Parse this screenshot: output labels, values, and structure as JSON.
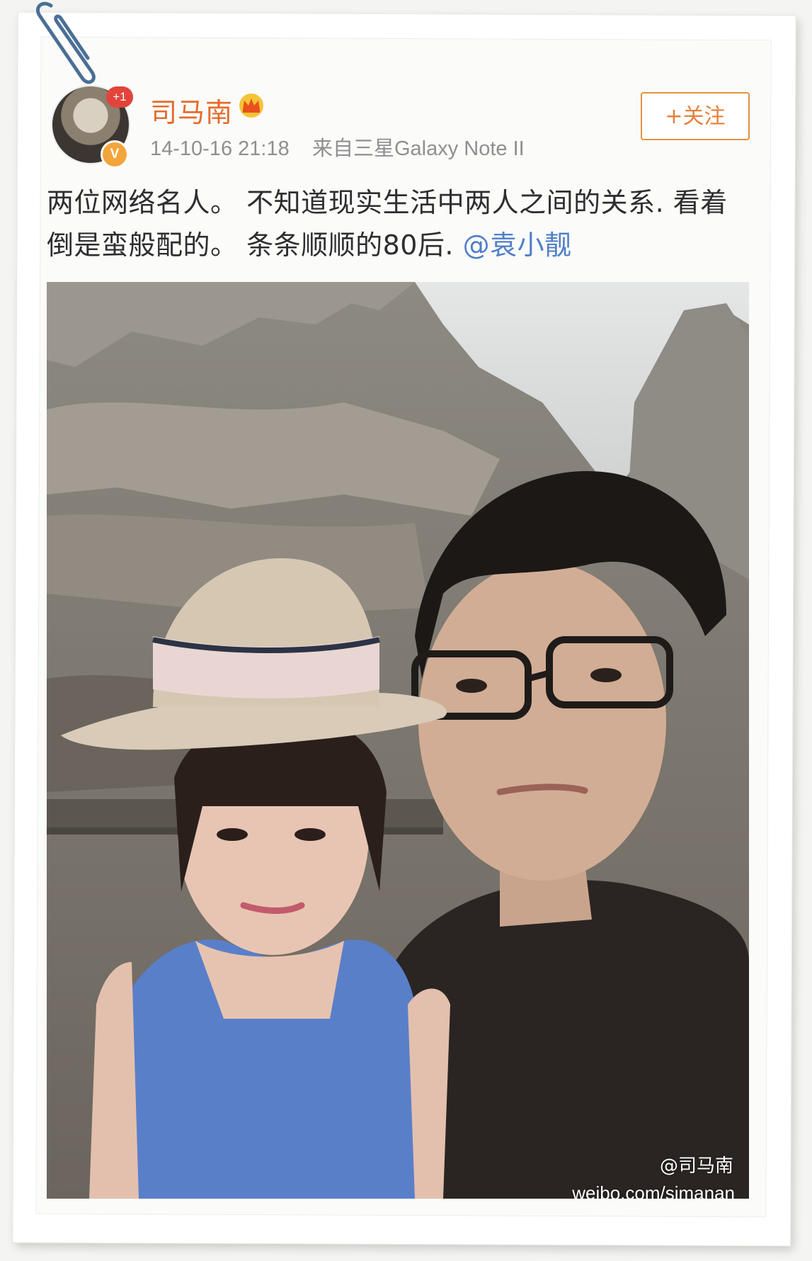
{
  "post": {
    "author": "司马南",
    "notification_badge": "+1",
    "verified_badge": "V",
    "timestamp": "14-10-16 21:18",
    "source": "来自三星Galaxy Note II",
    "follow_label": "+关注",
    "text": "两位网络名人。 不知道现实生活中两人之间的关系. 看着倒是蛮般配的。 条条顺顺的80后. ",
    "mention": "@袁小靓"
  },
  "photo": {
    "watermark_user": "@司马南",
    "watermark_url": "weibo.com/simanan"
  },
  "icons": {
    "crown": "crown-icon",
    "paperclip": "paperclip-icon"
  },
  "colors": {
    "username": "#e56b2c",
    "follow_border": "#e6913f",
    "mention": "#4f7fc8",
    "badge_red": "#e2443b",
    "badge_orange": "#f3a43b"
  }
}
